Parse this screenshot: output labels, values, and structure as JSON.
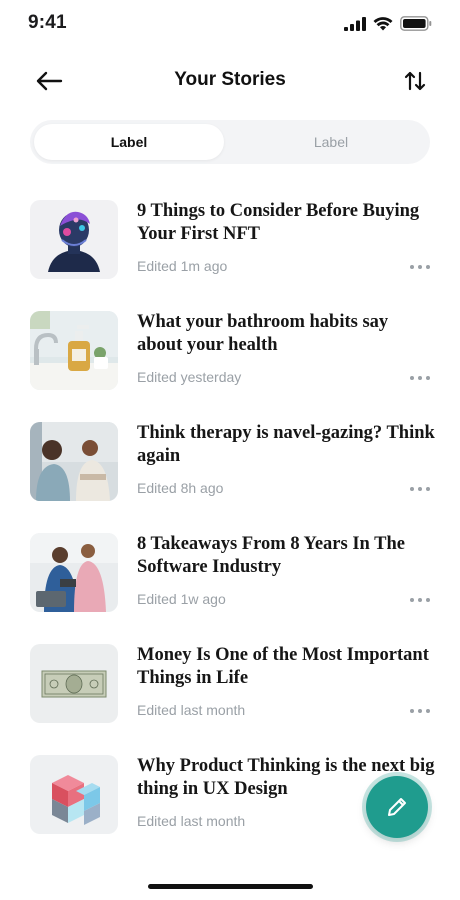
{
  "status_bar": {
    "time": "9:41"
  },
  "header": {
    "title": "Your Stories"
  },
  "tabs": [
    {
      "label": "Label",
      "active": true
    },
    {
      "label": "Label",
      "active": false
    }
  ],
  "stories": [
    {
      "title": "9 Things to Consider Before Buying Your First NFT",
      "meta": "Edited 1m ago",
      "thumbnail": "nft-bust-image"
    },
    {
      "title": "What your bathroom habits say about your health",
      "meta": "Edited yesterday",
      "thumbnail": "bathroom-sink-image"
    },
    {
      "title": "Think therapy is navel-gazing? Think again",
      "meta": "Edited 8h ago",
      "thumbnail": "therapy-session-image"
    },
    {
      "title": "8 Takeaways From 8 Years In The Software Industry",
      "meta": "Edited 1w ago",
      "thumbnail": "software-team-image"
    },
    {
      "title": "Money Is One of the Most Important Things in Life",
      "meta": "Edited last month",
      "thumbnail": "dollar-bill-image"
    },
    {
      "title": "Why Product Thinking is the next big thing in UX Design",
      "meta": "Edited last month",
      "thumbnail": "cube-blocks-image"
    }
  ],
  "fab": {
    "icon": "pencil-icon",
    "color": "#1f9c8e"
  },
  "colors": {
    "accent": "#1f9c8e",
    "muted": "#9aa0a6",
    "segment_bg": "#f3f4f6"
  }
}
